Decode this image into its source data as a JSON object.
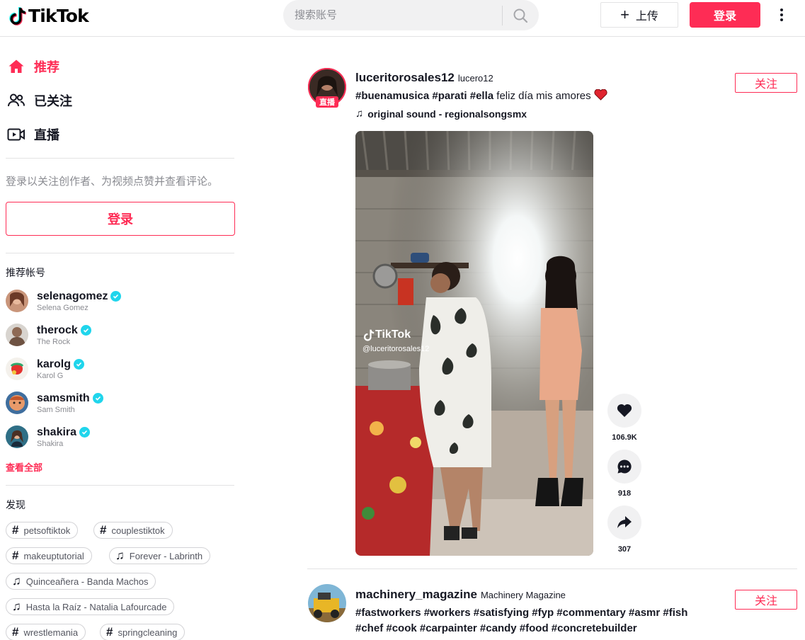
{
  "header": {
    "logo_text": "TikTok",
    "search_placeholder": "搜索账号",
    "upload_label": "上传",
    "login_label": "登录"
  },
  "sidebar": {
    "nav": [
      {
        "label": "推荐",
        "icon": "home-icon",
        "active": true
      },
      {
        "label": "已关注",
        "icon": "following-icon",
        "active": false
      },
      {
        "label": "直播",
        "icon": "live-icon",
        "active": false
      }
    ],
    "login_tip": "登录以关注创作者、为视频点赞并查看评论。",
    "login_button": "登录",
    "suggested_title": "推荐帐号",
    "accounts": [
      {
        "username": "selenagomez",
        "name": "Selena Gomez",
        "verified": true
      },
      {
        "username": "therock",
        "name": "The Rock",
        "verified": true
      },
      {
        "username": "karolg",
        "name": "Karol G",
        "verified": true
      },
      {
        "username": "samsmith",
        "name": "Sam Smith",
        "verified": true
      },
      {
        "username": "shakira",
        "name": "Shakira",
        "verified": true
      }
    ],
    "see_all": "查看全部",
    "discover_title": "发现",
    "tags": [
      {
        "type": "hashtag",
        "label": "petsoftiktok"
      },
      {
        "type": "hashtag",
        "label": "couplestiktok"
      },
      {
        "type": "hashtag",
        "label": "makeuptutorial"
      },
      {
        "type": "music",
        "label": "Forever - Labrinth"
      },
      {
        "type": "music",
        "label": "Quinceañera - Banda Machos"
      },
      {
        "type": "music",
        "label": "Hasta la Raíz - Natalia Lafourcade"
      },
      {
        "type": "hashtag",
        "label": "wrestlemania"
      },
      {
        "type": "hashtag",
        "label": "springcleaning"
      }
    ]
  },
  "posts": [
    {
      "username": "luceritorosales12",
      "nickname": "lucero12",
      "live_badge": "直播",
      "caption_tags": "#buenamusica #parati #ella",
      "caption_text": " feliz día mis amores ",
      "music": "original sound - regionalsongsmx",
      "follow_label": "关注",
      "watermark_brand": "TikTok",
      "watermark_user": "@luceritorosales12",
      "likes": "106.9K",
      "comments": "918",
      "shares": "307"
    },
    {
      "username": "machinery_magazine",
      "nickname": "Machinery Magazine",
      "caption_line1": "#fastworkers #workers #satisfying #fyp #commentary #asmr #fish",
      "caption_line2": "#chef #cook #carpainter #candy #food #concretebuilder",
      "follow_label": "关注"
    }
  ],
  "colors": {
    "brand": "#fe2c55",
    "verified": "#20d5ec",
    "text": "#161823",
    "muted": "#8a8b91"
  }
}
